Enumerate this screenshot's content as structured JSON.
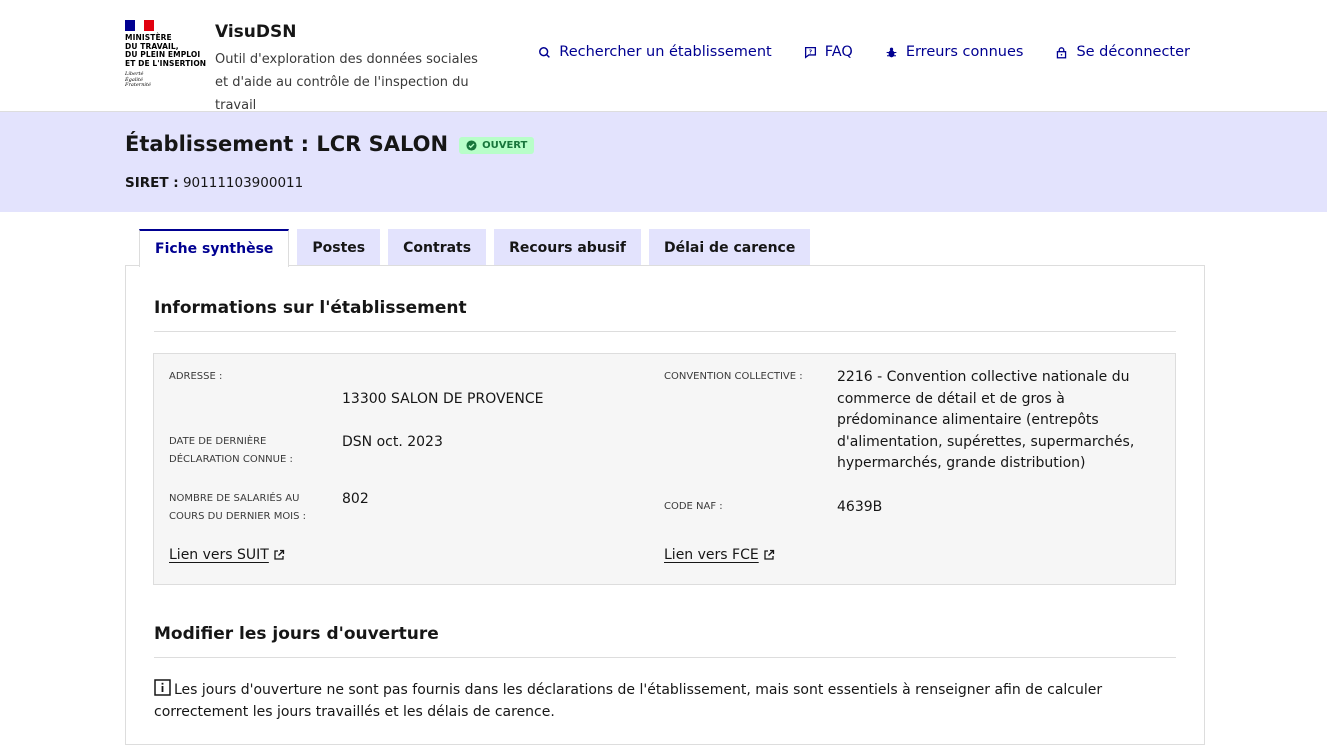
{
  "header": {
    "logo": {
      "ministry_lines": [
        "MINISTÈRE",
        "DU TRAVAIL,",
        "DU PLEIN EMPLOI",
        "ET DE L'INSERTION"
      ],
      "motto_lines": [
        "Liberté",
        "Égalité",
        "Fraternité"
      ],
      "flag_colors": [
        "#000091",
        "#ffffff",
        "#e1000f"
      ]
    },
    "service_title": "VisuDSN",
    "service_tagline": "Outil d'exploration des données sociales et d'aide au contrôle de l'inspection du travail",
    "nav": [
      {
        "label": "Rechercher un établissement",
        "icon": "search-icon"
      },
      {
        "label": "FAQ",
        "icon": "question-bubble-icon"
      },
      {
        "label": "Erreurs connues",
        "icon": "bug-icon"
      },
      {
        "label": "Se déconnecter",
        "icon": "lock-icon"
      }
    ]
  },
  "banner": {
    "title": "Établissement : LCR SALON",
    "status_badge": "OUVERT",
    "siret_label": "SIRET :",
    "siret_value": "90111103900011"
  },
  "tabs": [
    {
      "label": "Fiche synthèse",
      "active": true
    },
    {
      "label": "Postes",
      "active": false
    },
    {
      "label": "Contrats",
      "active": false
    },
    {
      "label": "Recours abusif",
      "active": false
    },
    {
      "label": "Délai de carence",
      "active": false
    }
  ],
  "info_section": {
    "title": "Informations sur l'établissement",
    "address_label": "ADRESSE :",
    "address_value": "13300 SALON DE PROVENCE",
    "last_dsn_label_line1": "DATE DE DERNIÈRE",
    "last_dsn_label_line2": "DÉCLARATION CONNUE :",
    "last_dsn_value": "DSN oct. 2023",
    "employees_label_line1": "NOMBRE DE SALARIÉS AU",
    "employees_label_line2": "COURS DU DERNIER MOIS :",
    "employees_value": "802",
    "convention_label": "CONVENTION COLLECTIVE :",
    "convention_lines": [
      "2216 - Convention collective nationale du",
      "commerce de détail et de gros à",
      "prédominance alimentaire (entrepôts",
      "d'alimentation, supérettes, supermarchés,",
      "hypermarchés, grande distribution)"
    ],
    "naf_label": "CODE NAF :",
    "naf_value": "4639B",
    "link_suit": "Lien vers SUIT",
    "link_fce": "Lien vers FCE"
  },
  "opening_section": {
    "title": "Modifier les jours d'ouverture",
    "notice_line1": "Les jours d'ouverture ne sont pas fournis dans les déclarations de l'établissement, mais sont essentiels à renseigner afin de calculer",
    "notice_line2": "correctement les jours travaillés et les délais de carence."
  },
  "colors": {
    "primary_blue": "#000091",
    "banner_bg": "#e3e3fd",
    "badge_bg": "#b8fec9",
    "badge_text": "#18753c"
  }
}
